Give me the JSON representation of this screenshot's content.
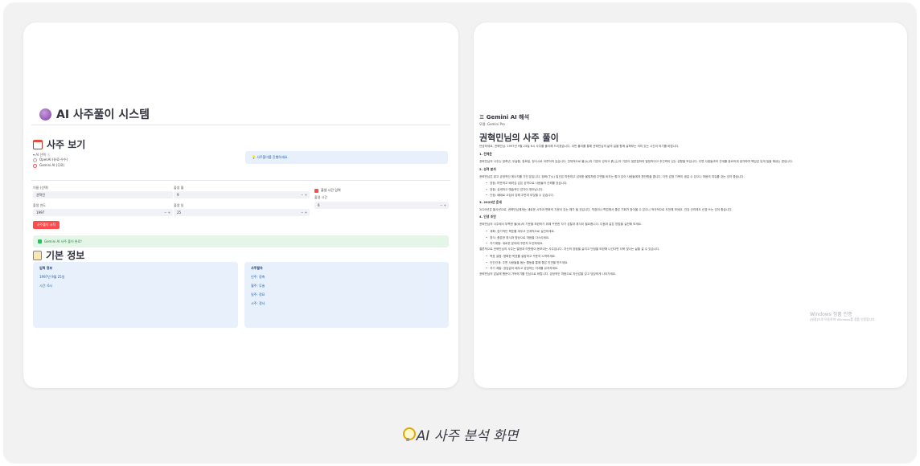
{
  "left_app": {
    "title": "AI 사주풀이 시스템",
    "section_view": "사주 보기",
    "ai_select_label": "▾ AI 선택 ⓘ",
    "radio_1": "OpenAI (유료-우수)",
    "radio_2": "Gemini AI (무료)",
    "info_msg": "💡 사주풀이를 진행하세요.",
    "form": {
      "name_label": "이름 (선택)",
      "name_value": "권혁민",
      "year_label": "출생 연도",
      "year_value": "1997",
      "month_label": "출생 월",
      "month_value": "9",
      "day_label": "출생 일",
      "day_value": "25",
      "time_label": "출생 시간 입력",
      "hour_label": "출생 시간",
      "hour_value": "6"
    },
    "submit_button": "사주풀이 시작",
    "success_msg": "Gemini AI 사주 풀이 완료!",
    "section_basic": "기본 정보",
    "panel_left": {
      "header": "입력 정보",
      "rows": [
        "1997년 9월 25일",
        "시간: 6시"
      ]
    },
    "panel_right": {
      "header": "사주팔자",
      "rows": [
        "년주: 정축",
        "월주: 무술",
        "일주: 정묘",
        "시주: 정사"
      ]
    }
  },
  "right_app": {
    "gemini_heading": "♊ Gemini AI 해석",
    "model_line": "모델: Gemini Pro",
    "result_title": "권혁민님의 사주 풀이",
    "intro": "안녕하세요, 권혁민님. 1997년 9월 25일 6시 사주를 풀이해 드리겠습니다. 이번 풀이를 통해 권혁민님의 삶의 길을 함께 살펴보는 의미 있는 시간이 되기를 바랍니다.",
    "sec1": "1. 전체운",
    "p1": "권혁민님의 사주는 정축년, 무술월, 정묘일, 정사시로 이루어져 있습니다. 전체적으로 불(火)의 기운이 강하고 흙(土)의 기운이 뒷받침하여 열정적이고 추진력이 있는 성향을 보입니다. 주변 사람들과의 관계를 중요하게 생각하며 책임감 있게 일을 해내는 편입니다.",
    "sec2": "2. 성격 분석",
    "p2": "권혁민님은 밝고 긍정적인 에너지를 가진 분입니다. 정화(丁火) 일간은 따뜻하고 섬세한 불빛처럼 주변을 비추는 힘이 있어 사람들에게 편안함을 줍니다. 다만 감정 기복이 생길 수 있으니 마음의 여유를 갖는 것이 좋습니다.",
    "list2": [
      "장점: 따뜻하고 배려심 깊은 성격으로 사람들의 신뢰를 얻습니다.",
      "장점: 섬세하고 예술적인 감각이 뛰어납니다.",
      "단점: 때때로 고집이 강해 주변과 부딪힐 수 있습니다."
    ],
    "sec3": "3. 2025년 운세",
    "p3": "2025년은 을사년으로, 권혁민님에게는 새로운 시작과 변화의 기운이 있는 해가 될 것입니다. 직장이나 학업에서 좋은 기회가 찾아올 수 있으니 적극적으로 도전해 보세요. 건강 관리에도 신경 쓰는 것이 좋습니다.",
    "sec4": "4. 인생 조언",
    "p4": "권혁민님의 사주에서 부족한 물(水)의 기운을 보완하기 위해 꾸준한 자기 성찰과 휴식이 필요합니다. 다음과 같은 방법을 실천해 보세요.",
    "list4": [
      "계획: 장기적인 목표를 세우고 단계적으로 실천하세요.",
      "휴식: 충분한 휴식과 명상으로 마음을 다스리세요.",
      "자기계발: 새로운 분야에 꾸준히 도전하세요."
    ],
    "p5": "결론적으로 권혁민님의 사주는 열정과 따뜻함이 돋보이는 사주입니다. 자신의 장점을 살리고 단점을 보완해 나간다면 더욱 빛나는 삶을 살 수 있습니다.",
    "list5": [
      "목표 설정: 명확한 목표를 설정하고 꾸준히 노력하세요.",
      "인간관계: 주변 사람들을 돕는 활동을 통해 좋은 인연을 만드세요.",
      "자기 계발: 끊임없이 배우고 성장하는 자세를 유지하세요."
    ],
    "p6": "권혁민님의 앞날에 행운이 가득하기를 진심으로 바랍니다. 긍정적인 마음으로 자신감을 갖고 당당하게 나아가세요."
  },
  "watermark": {
    "line1": "Windows 정품 인증",
    "line2": "[설정]으로 이동하여 Windows를 정품 인증합니다."
  },
  "caption": "AI 사주 분석 화면"
}
